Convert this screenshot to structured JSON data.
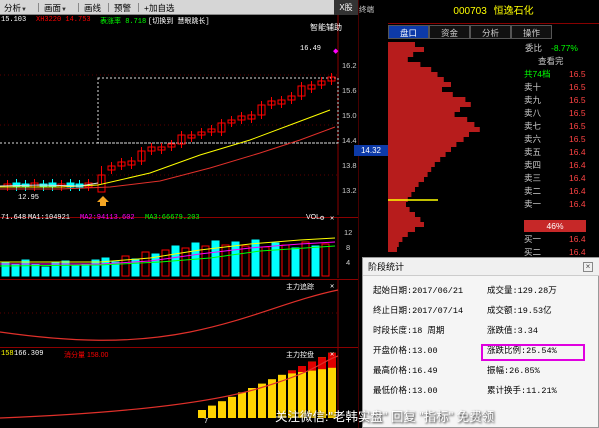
{
  "toolbar": {
    "items": [
      {
        "label": "分析",
        "arrow": "▼"
      },
      {
        "label": "画面",
        "arrow": "▼"
      },
      {
        "label": "画线",
        "arrow": ""
      },
      {
        "label": "预警",
        "arrow": ""
      },
      {
        "label": "+加自选",
        "arrow": ""
      }
    ],
    "close_label": "X股"
  },
  "main_chart": {
    "info_values": [
      "15.103",
      "XH3220 14.753",
      "表涨率 8.718",
      "[切换到 慧眼跳长]"
    ],
    "info_colors": [
      "#fff",
      "#ff0000",
      "#00ff00",
      "#fff"
    ],
    "side_label": "智能辅助",
    "high_label": "16.49",
    "low_label": "12.95",
    "axis_labels": [
      "16.2",
      "15.6",
      "15.0",
      "14.4",
      "13.8",
      "13.2"
    ],
    "price_tag": "14.32"
  },
  "volume_panel": {
    "info_values": [
      "71.648",
      "MA1:104921",
      "MA2:94113.602",
      "MA3:66679.203"
    ],
    "info_colors": [
      "#fff",
      "#fff",
      "#ff00ff",
      "#00ff00"
    ],
    "right_label": "VOL",
    "axis_labels": [
      "12",
      "8",
      "4"
    ]
  },
  "panel_trend": {
    "right_label": "主力追踪",
    "axis_labels": [
      "",
      ""
    ]
  },
  "panel_control": {
    "info_values": [
      "158",
      "166.309",
      "消分量 158.00"
    ],
    "info_colors": [
      "#ffff00",
      "#fff",
      "#ff0000"
    ],
    "right_label": "主力控盘",
    "bottom_labels": [
      "",
      "7"
    ]
  },
  "right_panel": {
    "stock_code": "000703",
    "stock_name": "恒逸石化",
    "tabs": [
      "盘口",
      "资金",
      "分析",
      "操作"
    ],
    "ratio_label": "委比",
    "ratio_value": "-8.77%",
    "view_more": "查看完",
    "total_label": "共74档",
    "sell_labels": [
      "卖十",
      "卖九",
      "卖八",
      "卖七",
      "卖六",
      "卖五",
      "卖四",
      "卖三",
      "卖二",
      "卖一"
    ],
    "sell_prices": [
      "16.5",
      "16.5",
      "16.5",
      "16.5",
      "16.5",
      "16.4",
      "16.4",
      "16.4",
      "16.4",
      "16.4"
    ],
    "percent_badge": "46%",
    "buy_labels": [
      "买一",
      "买二"
    ],
    "buy_prices": [
      "16.4",
      "16.4"
    ],
    "chip_axis": [
      "16.2",
      "15.6",
      "15.0",
      "14.4",
      "14.32",
      "13.8",
      "13.2",
      "12"
    ]
  },
  "dialog": {
    "title": "阶段统计",
    "close_label": "×",
    "rows": [
      {
        "left": "起始日期:2017/06/21",
        "right": "成交量:129.28万"
      },
      {
        "left": "终止日期:2017/07/14",
        "right": "成交额:19.53亿"
      },
      {
        "left": "时段长度:18 周期",
        "right": "涨跌值:3.34"
      },
      {
        "left": "开盘价格:13.00",
        "right": "涨跌比例:25.54%"
      },
      {
        "left": "最高价格:16.49",
        "right": "振幅:26.85%"
      },
      {
        "left": "最低价格:13.00",
        "right": "累计换手:11.21%"
      }
    ]
  },
  "watermark": "关注微信:\"老韩实盘\" 回复 \"指标\" 免费领",
  "colors": {
    "up": "#ff0000",
    "down": "#00ffff",
    "ma_yellow": "#ffff00",
    "ma_red": "#e0302a",
    "grid_red": "#8b0000",
    "highlight_box": "#e000e0"
  }
}
